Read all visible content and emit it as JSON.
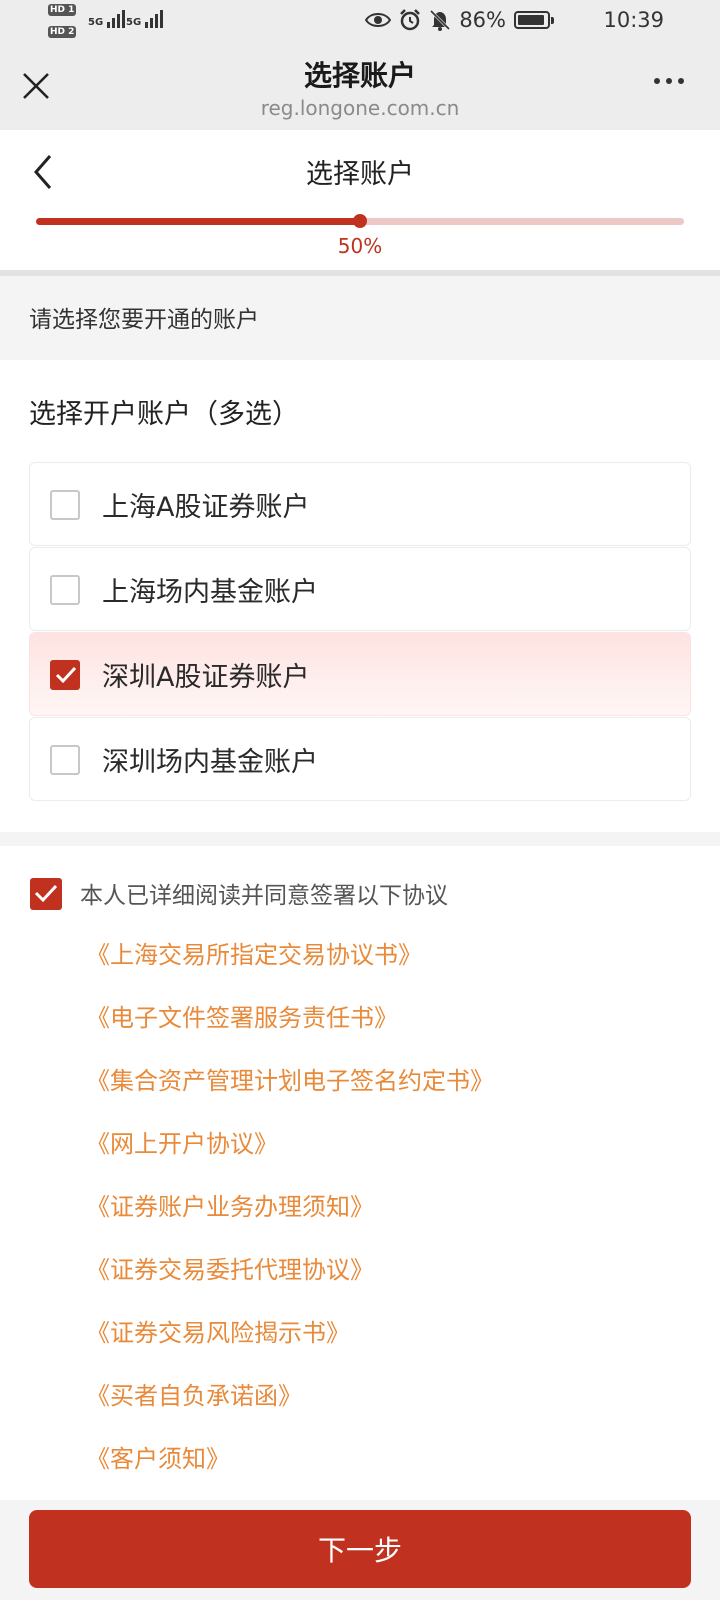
{
  "status_bar": {
    "hd1": "HD 1",
    "hd2": "HD 2",
    "net1": "5G",
    "net2": "5G",
    "battery": "86%",
    "time": "10:39",
    "icons": [
      "eye-icon",
      "alarm-icon",
      "bell-off-icon",
      "battery-icon"
    ]
  },
  "browser": {
    "title": "选择账户",
    "url": "reg.longone.com.cn"
  },
  "header": {
    "title": "选择账户",
    "progress": 0.5,
    "progress_label": "50%"
  },
  "hint": "请选择您要开通的账户",
  "accounts": {
    "title": "选择开户账户（多选）",
    "items": [
      {
        "label": "上海A股证券账户",
        "checked": false
      },
      {
        "label": "上海场内基金账户",
        "checked": false
      },
      {
        "label": "深圳A股证券账户",
        "checked": true
      },
      {
        "label": "深圳场内基金账户",
        "checked": false
      }
    ]
  },
  "agreement": {
    "checked": true,
    "text": "本人已详细阅读并同意签署以下协议",
    "docs": [
      "《上海交易所指定交易协议书》",
      "《电子文件签署服务责任书》",
      "《集合资产管理计划电子签名约定书》",
      "《网上开户协议》",
      "《证券账户业务办理须知》",
      "《证券交易委托代理协议》",
      "《证券交易风险揭示书》",
      "《买者自负承诺函》",
      "《客户须知》"
    ]
  },
  "footer": {
    "next_label": "下一步"
  },
  "colors": {
    "accent": "#c0321f",
    "link": "#e88a3a",
    "progress_track": "#ecc9c5"
  }
}
